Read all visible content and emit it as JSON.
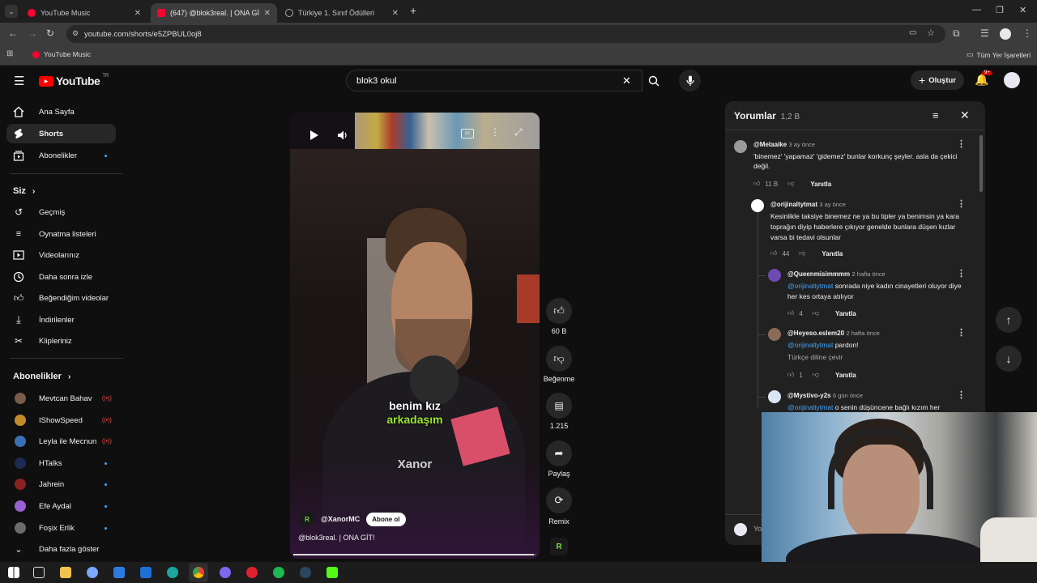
{
  "browser": {
    "tabs": [
      {
        "label": "YouTube Music"
      },
      {
        "label": "(647) @blok3real. | ONA GİT! -"
      },
      {
        "label": "Türkiye 1. Sınıf Ödülleri"
      }
    ],
    "url": "youtube.com/shorts/e5ZPBUL0oj8",
    "bookmark": "YouTube Music",
    "all_bookmarks": "Tüm Yer İşaretleri"
  },
  "header": {
    "logo_text": "YouTube",
    "country": "TR",
    "search_value": "blok3 okul",
    "create_label": "Oluştur",
    "notif_count": "9+"
  },
  "sidebar": {
    "main": [
      {
        "label": "Ana Sayfa",
        "icon": "home-icon"
      },
      {
        "label": "Shorts",
        "icon": "shorts-icon"
      },
      {
        "label": "Abonelikler",
        "icon": "subscriptions-icon"
      }
    ],
    "you_header": "Siz",
    "you": [
      {
        "label": "Geçmiş"
      },
      {
        "label": "Oynatma listeleri"
      },
      {
        "label": "Videolarınız"
      },
      {
        "label": "Daha sonra izle"
      },
      {
        "label": "Beğendiğim videolar"
      },
      {
        "label": "İndirilenler"
      },
      {
        "label": "Klipleriniz"
      }
    ],
    "subs_header": "Abonelikler",
    "subs": [
      {
        "label": "Mevtcan Bahav",
        "color": "#7a5b4a"
      },
      {
        "label": "IShowSpeed",
        "color": "#c58b2a"
      },
      {
        "label": "Leyla ile Mecnun",
        "color": "#3b6fb6"
      },
      {
        "label": "HTalks",
        "color": "#1c2a55"
      },
      {
        "label": "Jahrein",
        "color": "#8a2020"
      },
      {
        "label": "Efe Aydal",
        "color": "#9a5fd0"
      },
      {
        "label": "Foşix Erlik",
        "color": "#6b6b6b"
      }
    ],
    "show_more": "Daha fazla göster"
  },
  "short": {
    "caption_line1": "benim kız",
    "caption_line2": "arkadaşım",
    "watermark": "Xanor",
    "channel": "@XanorMC",
    "subscribe_label": "Abone ol",
    "title": "@blok3real. | ONA GİT!",
    "likes": "60 B",
    "dislike_label": "Beğenme",
    "comments_count": "1.215",
    "share_label": "Paylaş",
    "remix_label": "Remix",
    "progress": 0.99
  },
  "comments": {
    "title": "Yorumlar",
    "count": "1,2 B",
    "items": [
      {
        "author": "@Melaaike",
        "time": "3 ay önce",
        "text": "'binemez' 'yapamaz' 'gidemez' bunlar korkunç şeyler. asla da çekici değil.",
        "likes": "11 B",
        "reply": "Yanıtla"
      },
      {
        "author": "@orijinaltytmat",
        "time": "3 ay önce",
        "text": "Kesinlikle taksiye binemez ne ya bu tipler ya benimsin ya kara toprağın diyip haberlere çıkıyor genelde bunlara düşen kızlar varsa bi tedavi olsunlar",
        "likes": "44",
        "reply": "Yanıtla"
      },
      {
        "author": "@Queenmisimmmm",
        "time": "2 hafta önce",
        "mention": "@orijinaltytmat",
        "text": " sonrada niye kadın cinayetleri oluyor diye her kes ortaya atılıyor",
        "likes": "4",
        "reply": "Yanıtla"
      },
      {
        "author": "@Heyeso.eslem20",
        "time": "2 hafta önce",
        "mention": "@orijinaltytmat",
        "text": " pardon!",
        "translate": "Türkçe diline çevir",
        "likes": "1",
        "reply": "Yanıtla"
      },
      {
        "author": "@Mystivo-y2s",
        "time": "6 gün önce",
        "mention": "@orijinaltytmat",
        "text": " o senin düşüncene bağlı kızım her"
      }
    ],
    "input_placeholder": "Yo"
  }
}
